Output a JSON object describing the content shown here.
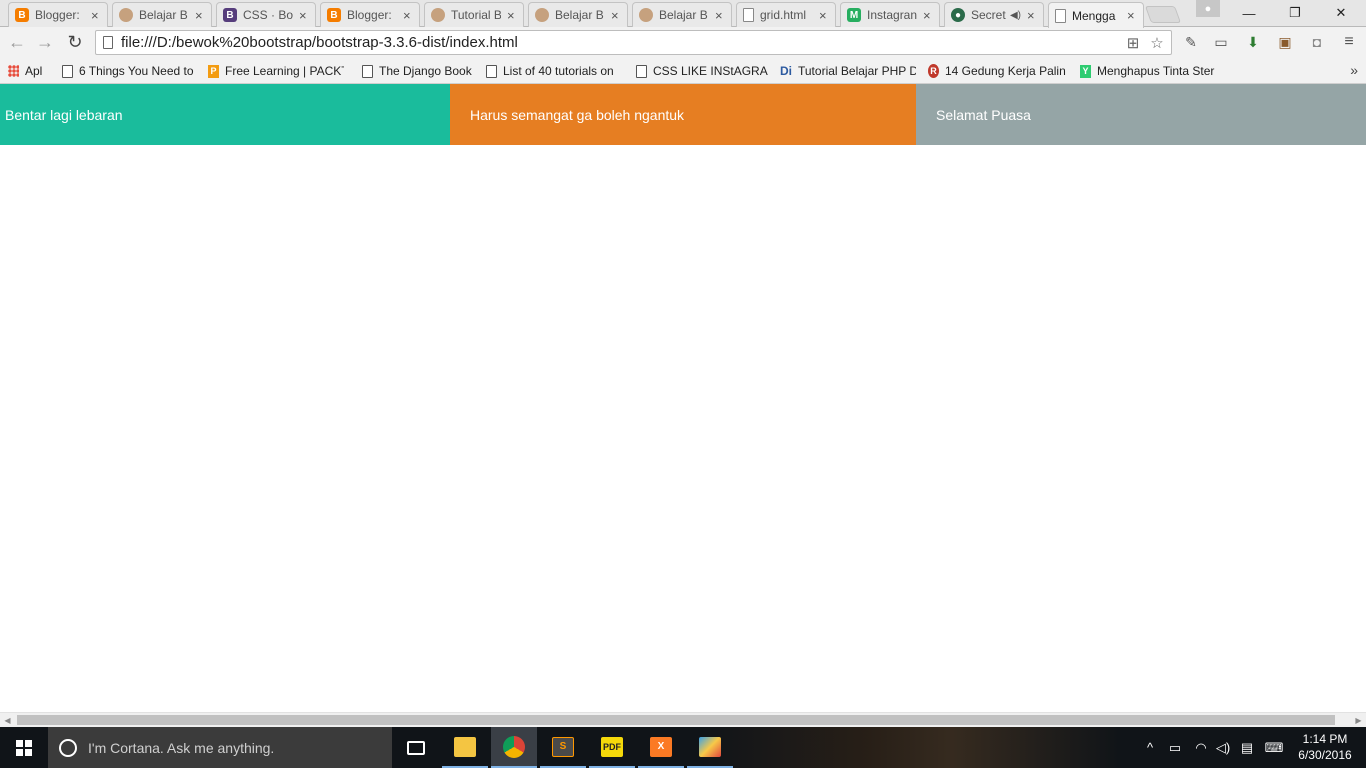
{
  "browser": {
    "tabs": [
      {
        "title": "Blogger:",
        "favicon": "blogger-icon",
        "active": false
      },
      {
        "title": "Belajar B",
        "favicon": "person-icon",
        "active": false
      },
      {
        "title": "CSS · Boo",
        "favicon": "bootstrap-icon",
        "active": false
      },
      {
        "title": "Blogger:",
        "favicon": "blogger-icon",
        "active": false
      },
      {
        "title": "Tutorial B",
        "favicon": "person-icon",
        "active": false
      },
      {
        "title": "Belajar B",
        "favicon": "person-icon",
        "active": false
      },
      {
        "title": "Belajar B",
        "favicon": "person-icon",
        "active": false
      },
      {
        "title": "grid.html",
        "favicon": "document-icon",
        "active": false
      },
      {
        "title": "Instagran",
        "favicon": "instagram-icon",
        "active": false
      },
      {
        "title": "Secret",
        "favicon": "camera-icon",
        "active": false
      },
      {
        "title": "Mengga",
        "favicon": "document-icon",
        "active": true
      }
    ],
    "tab_close_glyph": "×",
    "window_controls": {
      "minimize": "—",
      "restore": "❐",
      "close": "✕"
    },
    "nav": {
      "back": "←",
      "forward": "→",
      "reload": "↻"
    },
    "address_bar": {
      "url": "file:///D:/bewok%20bootstrap/bootstrap-3.3.6-dist/index.html"
    },
    "omnibox_icons": [
      "translate-icon",
      "bookmark-star-icon"
    ],
    "extension_icons": [
      "eyedropper-icon",
      "cast-icon",
      "download-icon",
      "instagram-icon",
      "camera-icon",
      "menu-icon"
    ],
    "bookmarks": [
      {
        "label": "Apl",
        "icon": "apps-icon"
      },
      {
        "label": "6 Things You Need to",
        "icon": "page-icon"
      },
      {
        "label": "Free Learning | PACKT",
        "icon": "packt-icon"
      },
      {
        "label": "The Django Book",
        "icon": "page-icon"
      },
      {
        "label": "List of 40 tutorials on",
        "icon": "page-icon"
      },
      {
        "label": "CSS LIKE INStAGRAM",
        "icon": "page-icon"
      },
      {
        "label": "Tutorial Belajar PHP D",
        "icon": "di-icon"
      },
      {
        "label": "14 Gedung Kerja Palin",
        "icon": "r-icon"
      },
      {
        "label": "Menghapus Tinta Ster",
        "icon": "leaf-icon"
      }
    ],
    "bookmarks_more": "»"
  },
  "page": {
    "columns": [
      {
        "text": "Bentar lagi lebaran",
        "color": "#1abc9c"
      },
      {
        "text": "Harus semangat ga boleh ngantuk",
        "color": "#e67e22"
      },
      {
        "text": "Selamat Puasa",
        "color": "#95a5a6"
      }
    ]
  },
  "taskbar": {
    "cortana_placeholder": "I'm Cortana. Ask me anything.",
    "apps": [
      "task-view-icon",
      "file-explorer-icon",
      "chrome-icon",
      "sublime-text-icon",
      "pdf-reader-icon",
      "xampp-icon",
      "paint-icon"
    ],
    "clock": {
      "time": "1:14 PM",
      "date": "6/30/2016"
    }
  }
}
